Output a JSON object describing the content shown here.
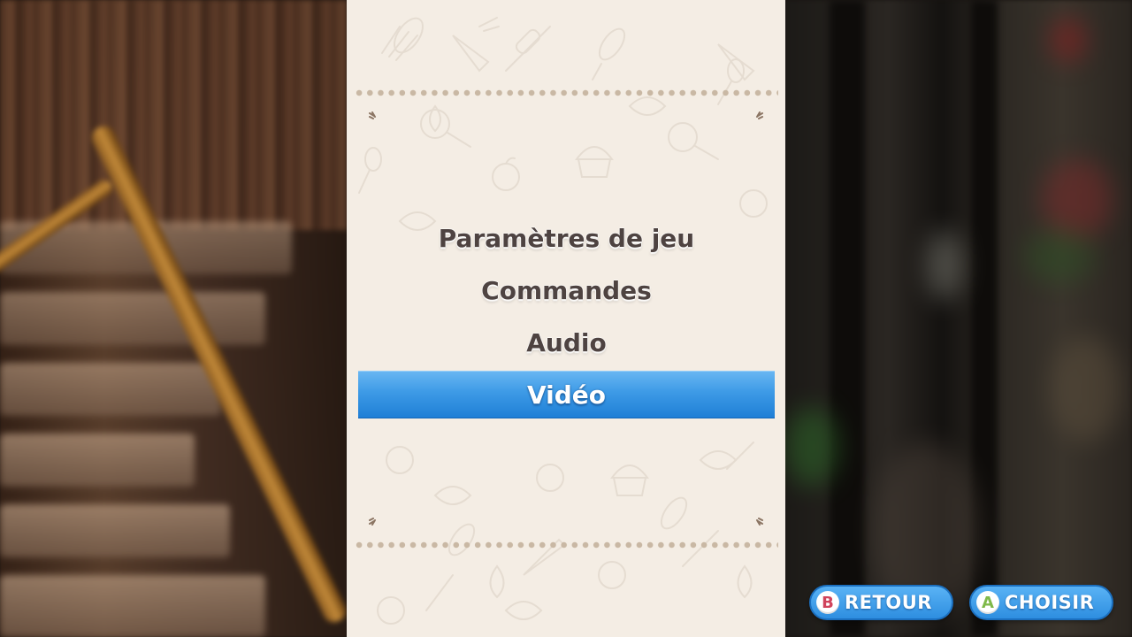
{
  "menu": {
    "items": [
      {
        "label": "Paramètres de jeu",
        "selected": false
      },
      {
        "label": "Commandes",
        "selected": false
      },
      {
        "label": "Audio",
        "selected": false
      },
      {
        "label": "Vidéo",
        "selected": true
      }
    ]
  },
  "controls": {
    "back": {
      "button": "B",
      "label": "RETOUR",
      "icon": "b-button-icon"
    },
    "select": {
      "button": "A",
      "label": "CHOISIR",
      "icon": "a-button-icon"
    }
  },
  "colors": {
    "panel_background": "#f4ede4",
    "selection_blue": "#3d9ae6",
    "menu_text": "#4e4341",
    "hint_blue": "#2e8ee0",
    "b_button": "#d0435c",
    "a_button": "#7fb94a"
  }
}
